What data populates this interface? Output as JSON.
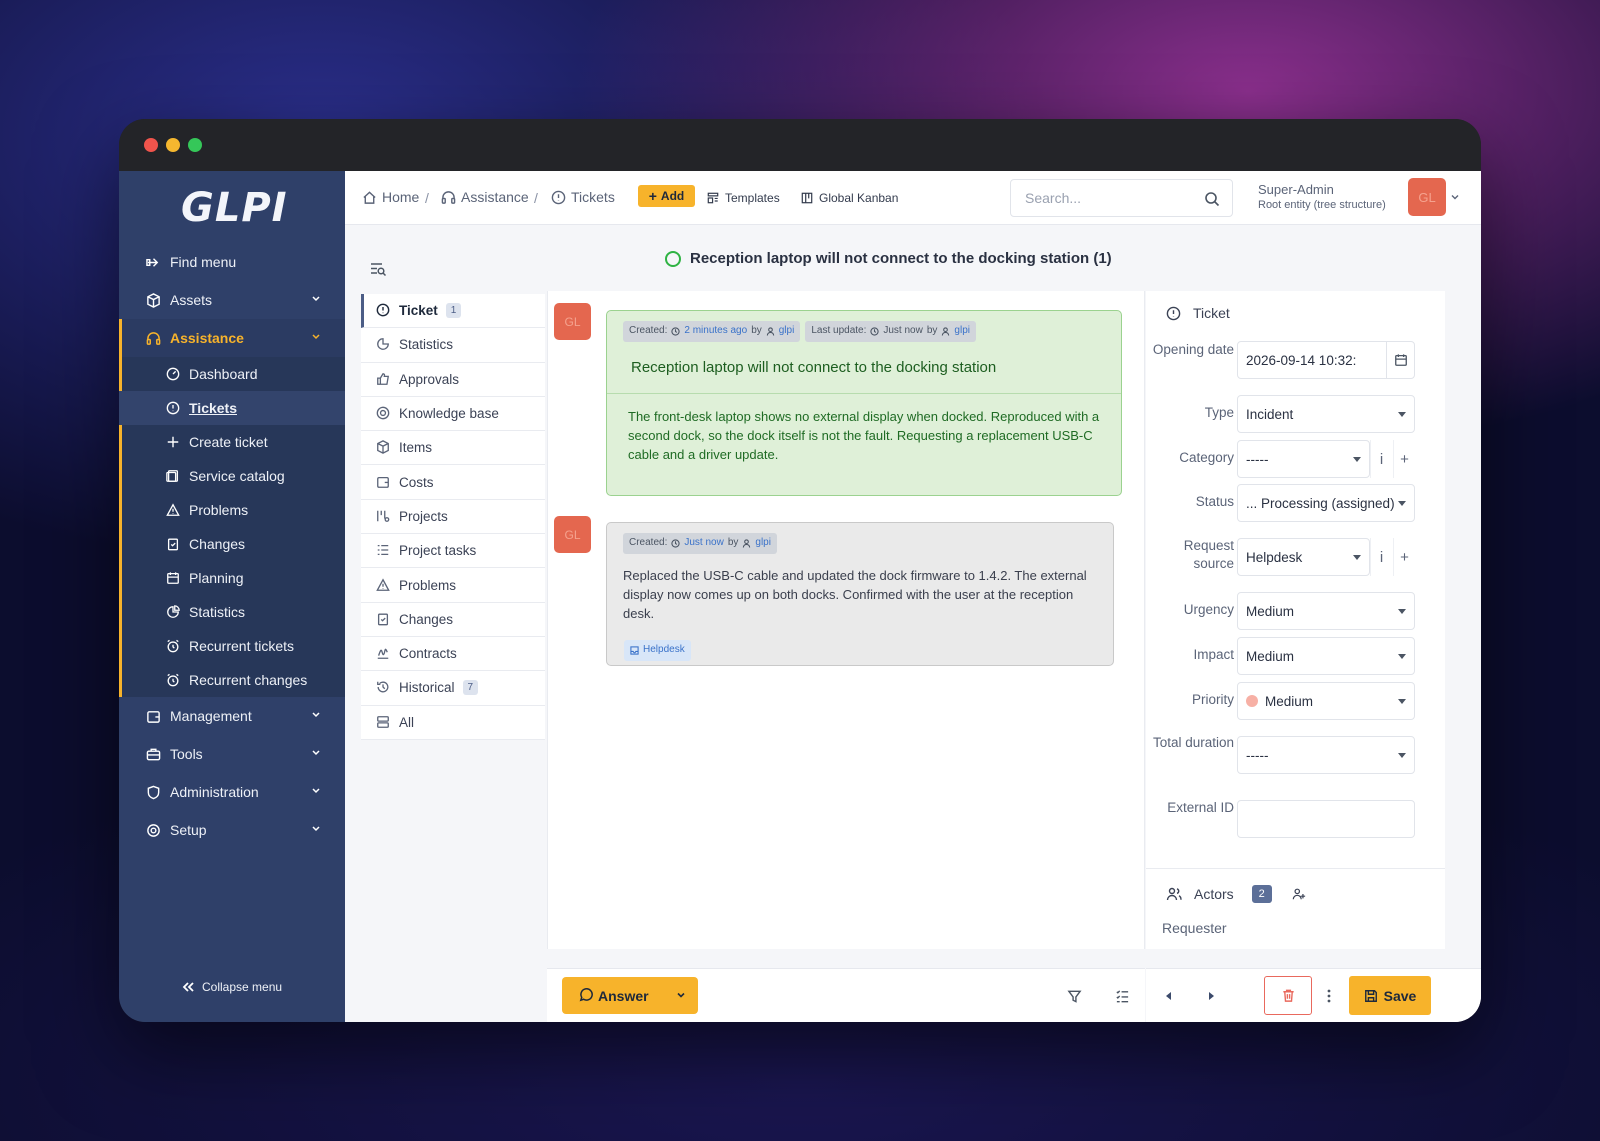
{
  "window": {
    "dots": [
      "#f0544c",
      "#f5b72f",
      "#35c759"
    ]
  },
  "sidebar": {
    "logo": "GLPI",
    "items": [
      {
        "label": "Find menu",
        "icon": "find-menu-icon"
      },
      {
        "label": "Assets",
        "icon": "box-icon"
      },
      {
        "label": "Assistance",
        "icon": "headset-icon"
      },
      {
        "label": "Management",
        "icon": "wallet-icon"
      },
      {
        "label": "Tools",
        "icon": "briefcase-icon"
      },
      {
        "label": "Administration",
        "icon": "shield-icon"
      },
      {
        "label": "Setup",
        "icon": "gear-icon"
      }
    ],
    "sub": [
      "Dashboard",
      "Tickets",
      "Create ticket",
      "Service catalog",
      "Problems",
      "Changes",
      "Planning",
      "Statistics",
      "Recurrent tickets",
      "Recurrent changes"
    ],
    "collapse": "Collapse menu"
  },
  "topbar": {
    "crumbs": [
      "Home",
      "Assistance",
      "Tickets"
    ],
    "add": "Add",
    "templates": "Templates",
    "kanban": "Global Kanban",
    "search_placeholder": "Search...",
    "user_name": "Super-Admin",
    "user_entity": "Root entity (tree structure)",
    "avatar": "GL"
  },
  "ticket": {
    "title": "Reception laptop will not connect to the docking station (1)"
  },
  "tabs": [
    {
      "label": "Ticket",
      "count": "1"
    },
    {
      "label": "Statistics"
    },
    {
      "label": "Approvals"
    },
    {
      "label": "Knowledge base"
    },
    {
      "label": "Items"
    },
    {
      "label": "Costs"
    },
    {
      "label": "Projects"
    },
    {
      "label": "Project tasks"
    },
    {
      "label": "Problems"
    },
    {
      "label": "Changes"
    },
    {
      "label": "Contracts"
    },
    {
      "label": "Historical",
      "count": "7"
    },
    {
      "label": "All"
    }
  ],
  "timeline": {
    "first": {
      "avatar": "GL",
      "created_label": "Created:",
      "created_when": "2 minutes ago",
      "by": "by",
      "author": "glpi",
      "update_label": "Last update:",
      "update_when": "Just now",
      "update_by": "by",
      "update_author": "glpi",
      "title": "Reception laptop will not connect to the docking station",
      "body": "The front-desk laptop shows no external display when docked. Reproduced with a second dock, so the dock itself is not the fault. Requesting a replacement USB-C cable and a driver update."
    },
    "second": {
      "avatar": "GL",
      "created_label": "Created:",
      "created_when": "Just now",
      "by": "by",
      "author": "glpi",
      "body": "Replaced the USB-C cable and updated the dock firmware to 1.4.2. The external display now comes up on both docks. Confirmed with the user at the reception desk.",
      "source": "Helpdesk"
    }
  },
  "bottom": {
    "answer": "Answer",
    "save": "Save"
  },
  "fields": {
    "header": "Ticket",
    "opening_date": {
      "label": "Opening date",
      "value": "2026-09-14 10:32:"
    },
    "type": {
      "label": "Type",
      "value": "Incident"
    },
    "category": {
      "label": "Category",
      "value": "-----"
    },
    "status": {
      "label": "Status",
      "value": "... Processing (assigned)"
    },
    "request_source": {
      "label": "Request source",
      "value": "Helpdesk"
    },
    "urgency": {
      "label": "Urgency",
      "value": "Medium"
    },
    "impact": {
      "label": "Impact",
      "value": "Medium"
    },
    "priority": {
      "label": "Priority",
      "value": "Medium"
    },
    "total_duration": {
      "label": "Total duration",
      "value": "-----"
    },
    "external_id": {
      "label": "External ID",
      "value": ""
    },
    "actors": {
      "label": "Actors",
      "count": "2"
    },
    "requester": "Requester"
  },
  "colors": {
    "accent": "#f7b32b",
    "sidebar": "#2f4069",
    "followup": "#dff0d8",
    "danger": "#e9695d"
  }
}
